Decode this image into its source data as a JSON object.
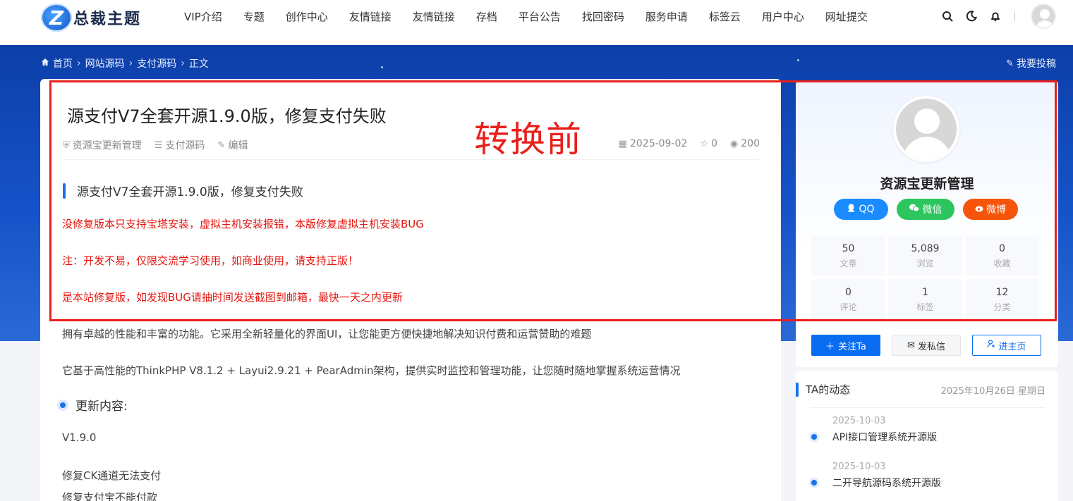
{
  "header": {
    "logo_letter": "Z",
    "logo_text": "总裁主题",
    "nav": [
      "VIP介绍",
      "专题",
      "创作中心",
      "友情链接",
      "友情链接",
      "存档",
      "平台公告",
      "找回密码",
      "服务申请",
      "标签云",
      "用户中心",
      "网址提交"
    ],
    "icons": [
      "search-icon",
      "theme-moon-icon",
      "bell-icon"
    ]
  },
  "breadcrumb": {
    "items": [
      "首页",
      "网站源码",
      "支付源码",
      "正文"
    ],
    "post_link": "我要投稿"
  },
  "article": {
    "title": "源支付V7全套开源1.9.0版，修复支付失败",
    "author": "资源宝更新管理",
    "category": "支付源码",
    "edit": "编辑",
    "date": "2025-09-02",
    "stars": "0",
    "views": "200",
    "h2": "源支付V7全套开源1.9.0版，修复支付失败",
    "red_lines": [
      "没修复版本只支持宝塔安装，虚拟主机安装报错，本版修复虚拟主机安装BUG",
      "注：开发不易，仅限交流学习使用，如商业使用，请支持正版！",
      "是本站修复版，如发现BUG请抽时间发送截图到邮箱，最快一天之内更新"
    ],
    "paragraphs": [
      "拥有卓越的性能和丰富的功能。它采用全新轻量化的界面UI，让您能更方便快捷地解决知识付费和运营赞助的难题",
      "它基于高性能的ThinkPHP V8.1.2 + Layui2.9.21 + PearAdmin架构，提供实时监控和管理功能，让您随时随地掌握系统运营情况"
    ],
    "h3": "更新内容:",
    "version": "V1.9.0",
    "changes": [
      "修复CK通道无法支付",
      "修复支付宝不能付款"
    ]
  },
  "overlay": {
    "stamp": "转换前",
    "box_color": "#e8201c"
  },
  "sidebar": {
    "name": "资源宝更新管理",
    "social": [
      {
        "label": "QQ",
        "icon": "qq-icon",
        "color": "#1a8cff"
      },
      {
        "label": "微信",
        "icon": "wechat-icon",
        "color": "#2dc55e"
      },
      {
        "label": "微博",
        "icon": "weibo-icon",
        "color": "#f5540a"
      }
    ],
    "stats": [
      {
        "value": "50",
        "label": "文章"
      },
      {
        "value": "5,089",
        "label": "浏览"
      },
      {
        "value": "0",
        "label": "收藏"
      },
      {
        "value": "0",
        "label": "评论"
      },
      {
        "value": "1",
        "label": "标签"
      },
      {
        "value": "12",
        "label": "分类"
      }
    ],
    "actions": {
      "follow": "关注Ta",
      "message": "发私信",
      "home": "进主页"
    }
  },
  "dynamics": {
    "title": "TA的动态",
    "today": "2025年10月26日 星期日",
    "items": [
      {
        "date": "2025-10-03",
        "text": "API接口管理系统开源版"
      },
      {
        "date": "2025-10-03",
        "text": "二开导航源码系统开源版"
      }
    ]
  }
}
